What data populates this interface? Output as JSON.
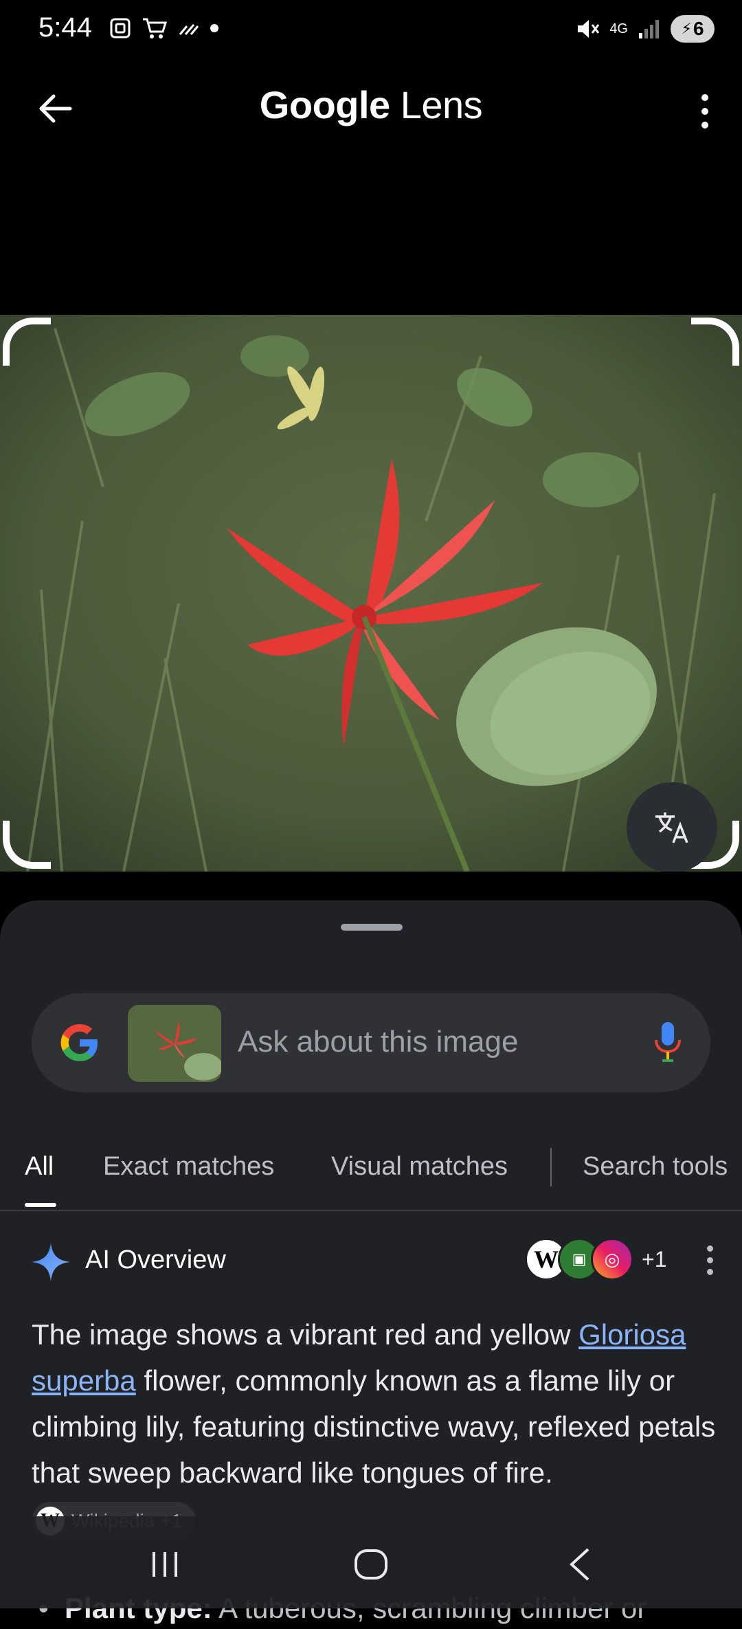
{
  "status_bar": {
    "time": "5:44",
    "network": "4G",
    "battery": "6"
  },
  "app": {
    "title_brand": "Google",
    "title_product": "Lens"
  },
  "search": {
    "placeholder": "Ask about this image"
  },
  "tabs": [
    {
      "label": "All",
      "active": true
    },
    {
      "label": "Exact matches",
      "active": false
    },
    {
      "label": "Visual matches",
      "active": false
    },
    {
      "label": "Search tools",
      "active": false
    }
  ],
  "ai_overview": {
    "title": "AI Overview",
    "sources_more": "+1",
    "text_before_link": "The image shows a vibrant red and yellow ",
    "link_text": "Gloriosa superba",
    "text_after_link": " flower, commonly known as a flame lily or climbing lily, featuring distinctive wavy, reflexed petals that sweep backward like tongues of fire.",
    "citation_chip": "Wikipedia +1",
    "bullet_label": "Plant type:",
    "bullet_text": " A tuberous, scrambling climber or"
  },
  "colors": {
    "accent_link": "#8ab4f8",
    "sheet_bg": "#202124",
    "searchbox_bg": "#303134"
  }
}
